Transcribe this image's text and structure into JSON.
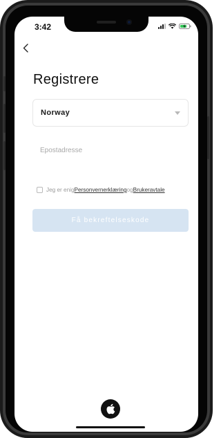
{
  "status_bar": {
    "time": "3:42"
  },
  "nav": {
    "back_icon": "chevron-left-icon"
  },
  "page": {
    "title": "Registrere"
  },
  "country_select": {
    "selected": "Norway"
  },
  "email": {
    "placeholder": "Epostadresse",
    "value": ""
  },
  "agreement": {
    "prefix": "Jeg er enig",
    "privacy_link": "Personvernerklæring",
    "joiner": "og",
    "terms_link": "Brukeravtale"
  },
  "submit": {
    "label": "Få bekreftelseskode"
  },
  "social": {
    "apple_icon": "apple-logo-icon"
  },
  "colors": {
    "button_disabled_bg": "#d6e4f2",
    "text_dark": "#111111",
    "placeholder": "#a9a9a9"
  }
}
